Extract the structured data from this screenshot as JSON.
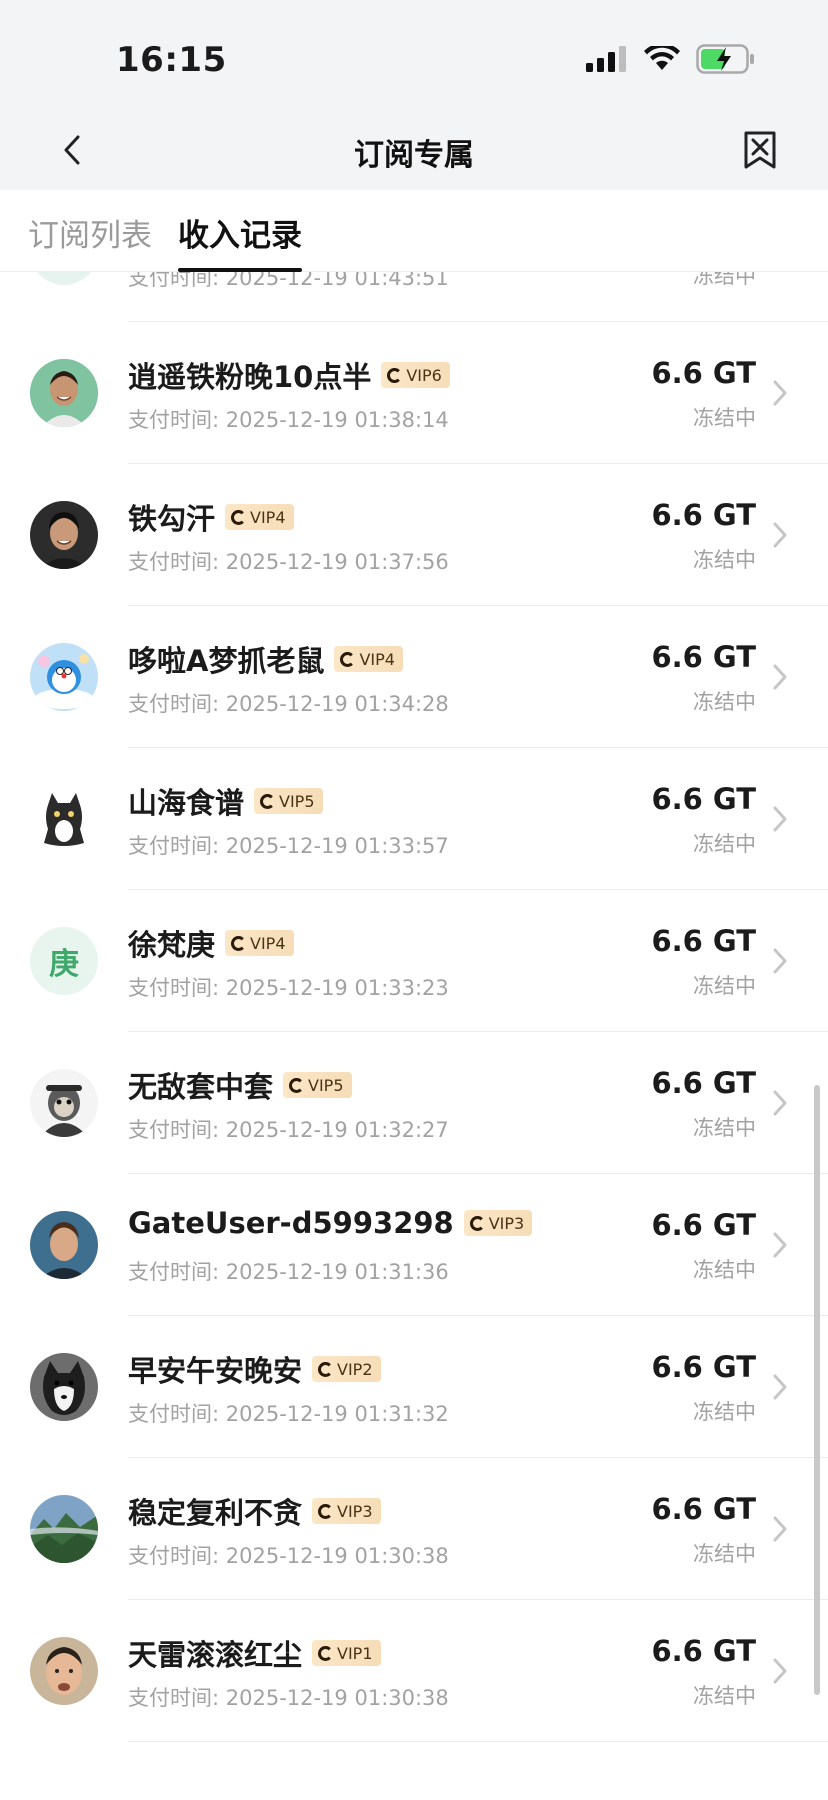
{
  "status_bar": {
    "time": "16:15"
  },
  "nav": {
    "title": "订阅专属"
  },
  "tabs": [
    {
      "label": "订阅列表",
      "active": false
    },
    {
      "label": "收入记录",
      "active": true
    }
  ],
  "partial_row": {
    "paid_time": "支付时间: 2025-12-19 01:43:51",
    "status": "冻结中"
  },
  "records": [
    {
      "name": "逍遥铁粉晚10点半",
      "vip": "VIP6",
      "paid_time": "支付时间: 2025-12-19 01:38:14",
      "amount": "6.6 GT",
      "status": "冻结中",
      "avatar": "photo-man-smiling"
    },
    {
      "name": "铁勾汗",
      "vip": "VIP4",
      "paid_time": "支付时间: 2025-12-19 01:37:56",
      "amount": "6.6 GT",
      "status": "冻结中",
      "avatar": "photo-man-dark"
    },
    {
      "name": "哆啦A梦抓老鼠",
      "vip": "VIP4",
      "paid_time": "支付时间: 2025-12-19 01:34:28",
      "amount": "6.6 GT",
      "status": "冻结中",
      "avatar": "doraemon"
    },
    {
      "name": "山海食谱",
      "vip": "VIP5",
      "paid_time": "支付时间: 2025-12-19 01:33:57",
      "amount": "6.6 GT",
      "status": "冻结中",
      "avatar": "cat"
    },
    {
      "name": "徐梵庚",
      "vip": "VIP4",
      "paid_time": "支付时间: 2025-12-19 01:33:23",
      "amount": "6.6 GT",
      "status": "冻结中",
      "avatar": "letter",
      "avatar_letter": "庚"
    },
    {
      "name": "无敌套中套",
      "vip": "VIP5",
      "paid_time": "支付时间: 2025-12-19 01:32:27",
      "amount": "6.6 GT",
      "status": "冻结中",
      "avatar": "monkey-king"
    },
    {
      "name": "GateUser-d5993298",
      "vip": "VIP3",
      "paid_time": "支付时间: 2025-12-19 01:31:36",
      "amount": "6.6 GT",
      "status": "冻结中",
      "avatar": "photo-young-man"
    },
    {
      "name": "早安午安晚安",
      "vip": "VIP2",
      "paid_time": "支付时间: 2025-12-19 01:31:32",
      "amount": "6.6 GT",
      "status": "冻结中",
      "avatar": "dog"
    },
    {
      "name": "稳定复利不贪",
      "vip": "VIP3",
      "paid_time": "支付时间: 2025-12-19 01:30:38",
      "amount": "6.6 GT",
      "status": "冻结中",
      "avatar": "mountain"
    },
    {
      "name": "天雷滚滚红尘",
      "vip": "VIP1",
      "paid_time": "支付时间: 2025-12-19 01:30:38",
      "amount": "6.6 GT",
      "status": "冻结中",
      "avatar": "photo-face"
    }
  ],
  "colors": {
    "accent_letter": "#3fa86b",
    "badge_bg": "#f7e2c2",
    "muted": "#a2a2a2"
  }
}
